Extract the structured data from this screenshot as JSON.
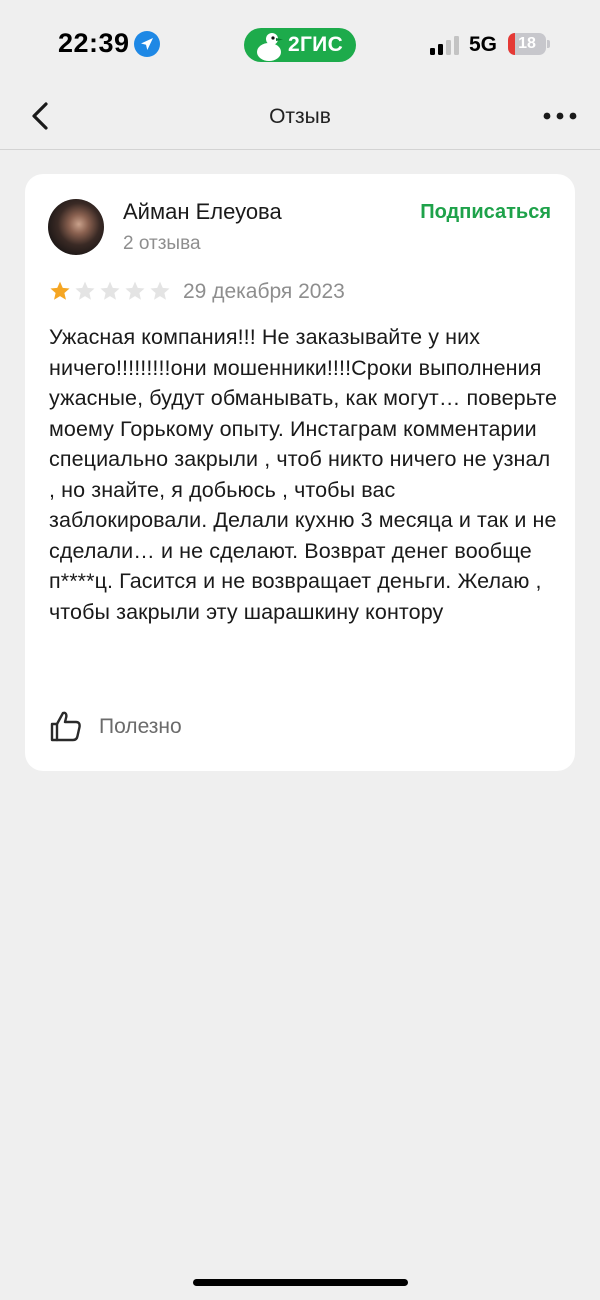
{
  "status_bar": {
    "time": "22:39",
    "network": "5G",
    "battery": "18",
    "battery_level": 0.18,
    "brand": "2ГИС",
    "icons": [
      "location-arrow-icon",
      "goose-icon",
      "signal-icon",
      "battery-icon"
    ]
  },
  "nav": {
    "title": "Отзыв",
    "icons": [
      "chevron-left-icon",
      "more-dots-icon"
    ]
  },
  "review": {
    "author": "Айман Елеуова",
    "review_count": "2 отзыва",
    "subscribe_label": "Подписаться",
    "rating": 1,
    "max_rating": 5,
    "date": "29 декабря 2023",
    "text": "Ужасная компания!!! Не заказывайте у них ничего!!!!!!!!!они мошенники!!!!Сроки выполнения ужасные, будут обманывать, как могут… поверьте моему Горькому опыту. Инстаграм комментарии специально закрыли , чтоб никто ничего не узнал , но знайте, я добьюсь , чтобы вас заблокировали. Делали кухню 3 месяца и так и не сделали… и не сделают. Возврат денег вообще п****ц. Гасится и не возвращает деньги. Желаю , чтобы закрыли эту шарашкину контору",
    "helpful_label": "Полезно"
  },
  "colors": {
    "accent_green": "#1ea24a",
    "star_filled": "#f5a623",
    "star_empty": "#e4e4e4",
    "background": "#efefef"
  }
}
